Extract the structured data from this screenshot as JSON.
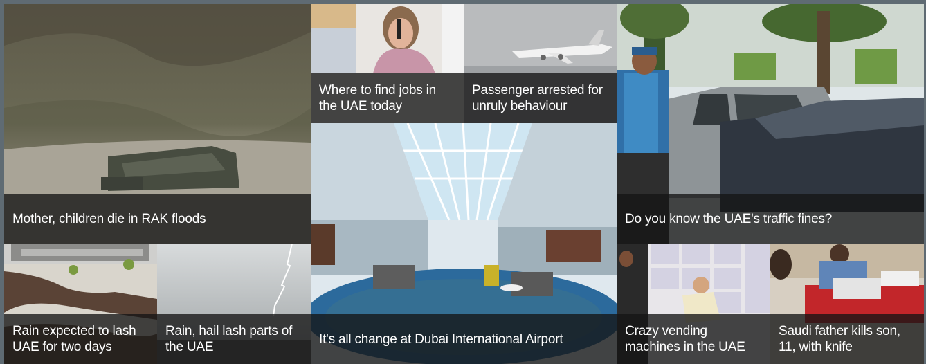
{
  "tiles": [
    {
      "id": "rak-floods",
      "caption": "Mother, children die in RAK floods"
    },
    {
      "id": "jobs",
      "caption": "Where to find jobs in the UAE today"
    },
    {
      "id": "passenger",
      "caption": "Passenger arrested for unruly behaviour"
    },
    {
      "id": "traffic-fines",
      "caption": "Do you know the UAE's traffic fines?"
    },
    {
      "id": "airport",
      "caption": "It's all change at Dubai International Airport"
    },
    {
      "id": "rain-expected",
      "caption": "Rain expected to lash UAE for two days"
    },
    {
      "id": "rain-hail",
      "caption": "Rain, hail lash parts of the UAE"
    },
    {
      "id": "vending",
      "caption": "Crazy vending machines in the UAE"
    },
    {
      "id": "saudi-father",
      "caption": "Saudi father kills son, 11, with knife"
    }
  ],
  "images": {
    "rak-floods": "flood-wrecked-car-photo",
    "jobs": "woman-on-phone-photo",
    "passenger": "airplane-photo",
    "traffic-fines": "traffic-officer-cars-photo",
    "airport": "airport-terminal-photo",
    "rain-expected": "flooded-road-photo",
    "rain-hail": "lightning-sky-photo",
    "vending": "vending-machine-photo",
    "saudi-father": "courtroom-photo"
  }
}
